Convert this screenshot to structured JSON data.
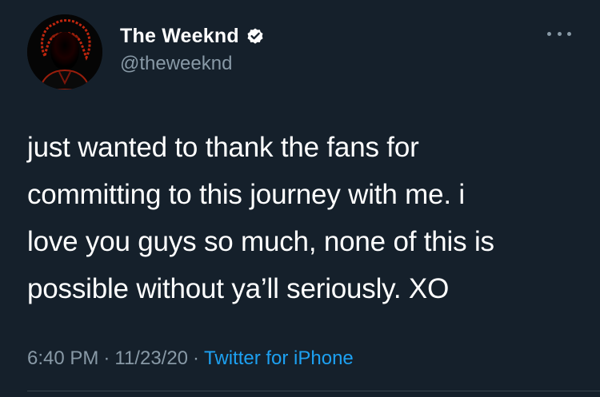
{
  "tweet": {
    "display_name": "The Weeknd",
    "handle": "@theweeknd",
    "verified": true,
    "more_icon": "more-horizontal-icon",
    "body_lines": [
      "just wanted to thank the fans for",
      "committing to this journey with me. i",
      "love you guys so much, none of this is",
      "possible without ya’ll seriously. XO"
    ],
    "time": "6:40 PM",
    "separator": "·",
    "date": "11/23/20",
    "source": "Twitter for iPhone"
  },
  "colors": {
    "background": "#15202b",
    "text": "#ffffff",
    "secondary_text": "#8899a6",
    "link": "#1da1f2",
    "divider": "#38444d"
  }
}
